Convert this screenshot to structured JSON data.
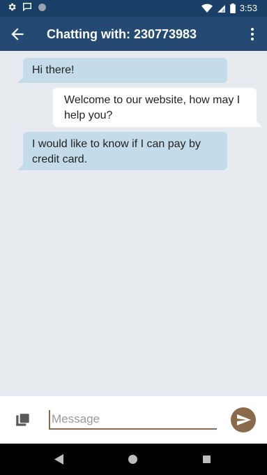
{
  "status_bar": {
    "time": "3:53",
    "icons": [
      "settings-icon",
      "message-icon",
      "circle-icon",
      "wifi-icon",
      "signal-icon",
      "battery-icon"
    ]
  },
  "app_bar": {
    "title": "Chatting with: 230773983",
    "back_icon": "arrow-left-icon",
    "menu_icon": "more-vert-icon",
    "color": "#244a73"
  },
  "chat": {
    "messages": [
      {
        "direction": "incoming",
        "text": "Hi there!"
      },
      {
        "direction": "outgoing",
        "text": "Welcome to our website, how may I help you?"
      },
      {
        "direction": "incoming",
        "text": "I would like to know if I can pay by credit card."
      }
    ],
    "incoming_color": "#c4dcea",
    "outgoing_color": "#ffffff"
  },
  "composer": {
    "placeholder": "Message",
    "value": "",
    "attach_icon": "attach-icon",
    "send_icon": "send-icon",
    "accent": "#8a6a4a"
  },
  "nav_bar": {
    "icons": [
      "back-triangle-icon",
      "home-circle-icon",
      "recents-square-icon"
    ]
  }
}
